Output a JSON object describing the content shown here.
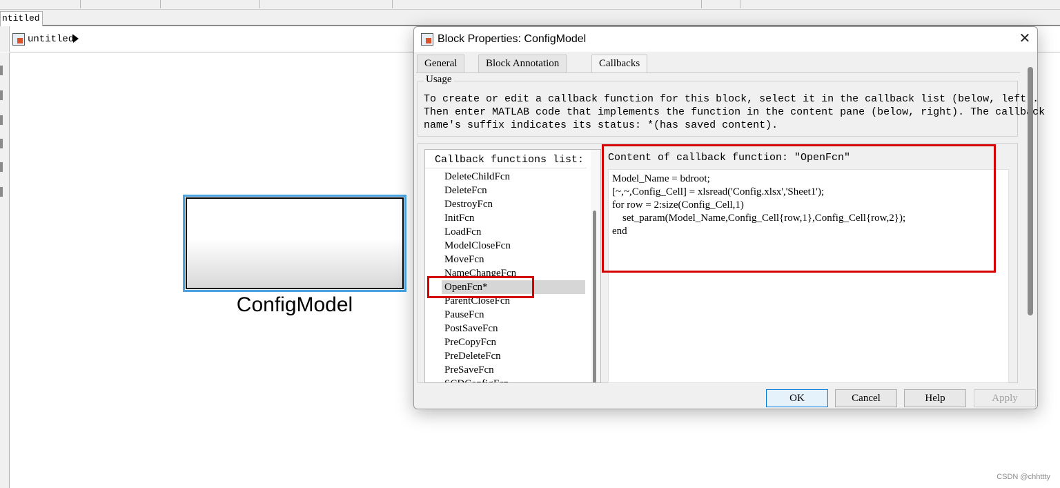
{
  "model_tab": {
    "label": "ntitled"
  },
  "breadcrumb": {
    "model_name": "untitled"
  },
  "canvas": {
    "block_label": "ConfigModel"
  },
  "watermark": "CSDN @chhttty",
  "dialog": {
    "title": "Block Properties: ConfigModel",
    "close_glyph": "✕",
    "tabs": [
      {
        "label": "General"
      },
      {
        "label": "Block Annotation"
      },
      {
        "label": "Callbacks"
      }
    ],
    "usage": {
      "legend": "Usage",
      "lines": [
        "To create or edit a callback function for this block, select it in the callback list (below, left).",
        "Then enter MATLAB code that implements the function in the content pane (below, right). The callback",
        "name's suffix indicates its status: *(has saved content)."
      ]
    },
    "callback_list": {
      "header": "Callback functions list:",
      "items": [
        "DeleteChildFcn",
        "DeleteFcn",
        "DestroyFcn",
        "InitFcn",
        "LoadFcn",
        "ModelCloseFcn",
        "MoveFcn",
        "NameChangeFcn",
        "OpenFcn*",
        "ParentCloseFcn",
        "PauseFcn",
        "PostSaveFcn",
        "PreCopyFcn",
        "PreDeleteFcn",
        "PreSaveFcn",
        "SCDConfigFcn"
      ],
      "selected": "OpenFcn*"
    },
    "content": {
      "header": "Content of callback function: \"OpenFcn\"",
      "code_lines": [
        "Model_Name = bdroot;",
        "[~,~,Config_Cell] = xlsread('Config.xlsx','Sheet1');",
        "for row = 2:size(Config_Cell,1)",
        "    set_param(Model_Name,Config_Cell{row,1},Config_Cell{row,2});",
        "end"
      ]
    },
    "buttons": {
      "ok": "OK",
      "cancel": "Cancel",
      "help": "Help",
      "apply": "Apply"
    }
  },
  "colors": {
    "highlight_red": "#d40000",
    "selection_blue": "#4ba3e3",
    "default_button_border": "#0078d7"
  }
}
